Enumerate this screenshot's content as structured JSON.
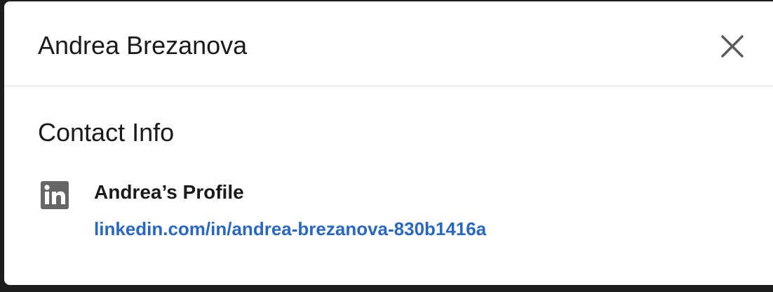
{
  "modal": {
    "title": "Andrea Brezanova",
    "close_icon": "close-icon"
  },
  "contact_info": {
    "heading": "Contact Info",
    "items": [
      {
        "icon": "linkedin-icon",
        "label": "Andrea’s Profile",
        "link": "linkedin.com/in/andrea-brezanova-830b1416a"
      }
    ]
  },
  "colors": {
    "link": "#2867c2",
    "icon": "#666666",
    "text": "#1a1a1a",
    "divider": "#e2e2e2"
  }
}
